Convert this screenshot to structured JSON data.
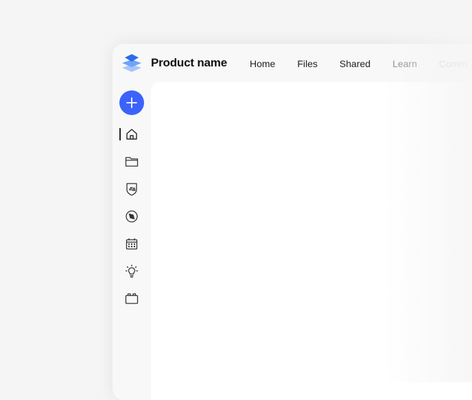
{
  "app": {
    "product_name": "Product name",
    "logo_icon": "layers-icon",
    "accent_color": "#3b63fb"
  },
  "top_nav": {
    "home": "Home",
    "files": "Files",
    "shared": "Shared",
    "learn": "Learn",
    "community": "Comm"
  },
  "sidebar": {
    "create_icon": "plus-icon",
    "active_item": "home",
    "items": [
      {
        "id": "home",
        "icon": "home-icon"
      },
      {
        "id": "files",
        "icon": "folder-icon"
      },
      {
        "id": "libraries",
        "icon": "shield-shapes-icon"
      },
      {
        "id": "discover",
        "icon": "compass-icon"
      },
      {
        "id": "calendar",
        "icon": "calendar-icon"
      },
      {
        "id": "learn",
        "icon": "lightbulb-icon"
      },
      {
        "id": "apps",
        "icon": "briefcase-icon"
      }
    ]
  }
}
